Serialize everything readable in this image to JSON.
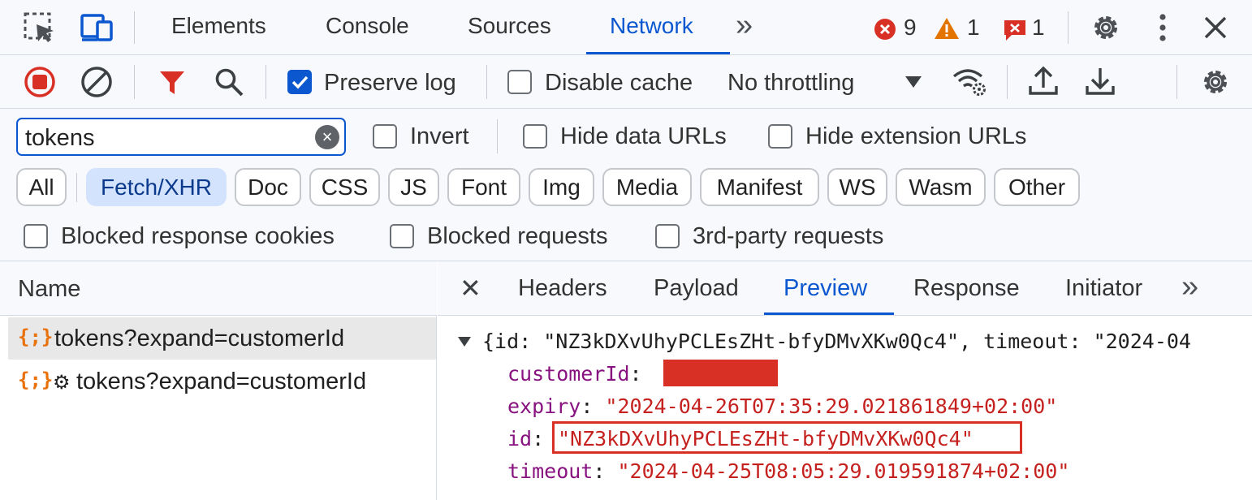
{
  "tabbar": {
    "tabs": [
      "Elements",
      "Console",
      "Sources",
      "Network"
    ],
    "active_tab": "Network",
    "more": "»",
    "errors_count": "9",
    "warnings_count": "1",
    "issues_count": "1"
  },
  "toolbar": {
    "preserve_log_label": "Preserve log",
    "preserve_log_checked": true,
    "disable_cache_label": "Disable cache",
    "disable_cache_checked": false,
    "throttling_value": "No throttling"
  },
  "filter": {
    "value": "tokens",
    "invert_label": "Invert",
    "hide_data_urls_label": "Hide data URLs",
    "hide_extension_urls_label": "Hide extension URLs"
  },
  "type_filters": [
    "All",
    "Fetch/XHR",
    "Doc",
    "CSS",
    "JS",
    "Font",
    "Img",
    "Media",
    "Manifest",
    "WS",
    "Wasm",
    "Other"
  ],
  "active_type_filter": "Fetch/XHR",
  "blocked": {
    "blocked_cookies_label": "Blocked response cookies",
    "blocked_requests_label": "Blocked requests",
    "third_party_label": "3rd-party requests"
  },
  "requests": {
    "column_header": "Name",
    "items": [
      {
        "icon": "{;}",
        "name": "tokens?expand=customerId",
        "selected": true
      },
      {
        "icon": "{;}",
        "prefix": "⚙",
        "name": "tokens?expand=customerId",
        "selected": false
      }
    ]
  },
  "detail": {
    "close": "✕",
    "tabs": [
      "Headers",
      "Payload",
      "Preview",
      "Response",
      "Initiator"
    ],
    "active_tab": "Preview",
    "more": "»"
  },
  "preview": {
    "summary": "{id: \"NZ3kDXvUhyPCLEsZHt-bfyDMvXKw0Qc4\", timeout: \"2024-04",
    "fields": [
      {
        "key": "customerId",
        "value": ""
      },
      {
        "key": "expiry",
        "value": "\"2024-04-26T07:35:29.021861849+02:00\""
      },
      {
        "key": "id",
        "value": "\"NZ3kDXvUhyPCLEsZHt-bfyDMvXKw0Qc4\""
      },
      {
        "key": "timeout",
        "value": "\"2024-04-25T08:05:29.019591874+02:00\""
      }
    ]
  },
  "colors": {
    "accent": "#0b57d0",
    "error": "#d93025",
    "warning": "#e37400",
    "json_key": "#881280",
    "json_string": "#c5221f",
    "redaction": "#d93025"
  },
  "icons": {
    "inspect": "inspect-element-icon",
    "device": "device-toolbar-icon",
    "record": "stop-recording-icon",
    "clear": "clear-icon",
    "filter": "filter-icon",
    "search": "search-icon",
    "network_conditions": "network-conditions-icon",
    "import": "import-har-icon",
    "export": "export-har-icon",
    "settings": "gear-icon",
    "kebab": "more-options-icon",
    "close": "close-icon"
  }
}
